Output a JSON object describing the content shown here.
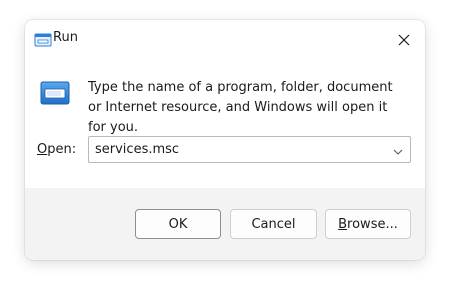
{
  "window": {
    "title": "Run",
    "description": "Type the name of a program, folder, document or Internet resource, and Windows will open it for you."
  },
  "open_field": {
    "label_accel": "O",
    "label_rest": "pen:",
    "value": "services.msc"
  },
  "buttons": {
    "ok": "OK",
    "cancel": "Cancel",
    "browse_accel": "B",
    "browse_rest": "rowse..."
  },
  "icons": {
    "title": "run-icon",
    "large": "run-large-icon",
    "close": "close-icon",
    "dropdown": "chevron-down-icon"
  },
  "colors": {
    "accent_blue": "#2b7fd8",
    "footer_bg": "#f3f3f3"
  }
}
